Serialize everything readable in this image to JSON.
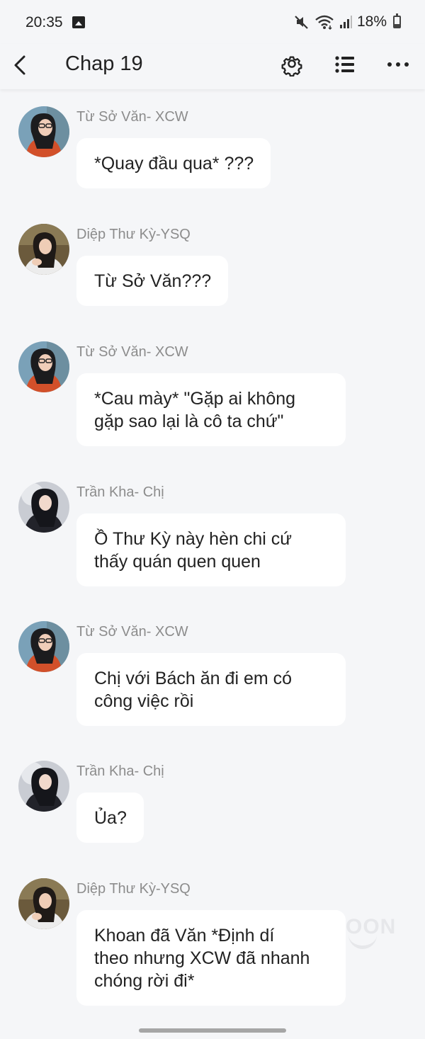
{
  "status_bar": {
    "time": "20:35",
    "battery": "18%",
    "icons": [
      "gallery-icon",
      "mute-icon",
      "wifi-icon",
      "signal-icon",
      "battery-icon"
    ]
  },
  "app_bar": {
    "title": "Chap 19",
    "icons": [
      "back-icon",
      "gear-icon",
      "list-icon",
      "more-icon"
    ]
  },
  "colors": {
    "background": "#f5f6f8",
    "bubble": "#ffffff",
    "name_text": "#8c8c8c",
    "text": "#222222"
  },
  "messages": [
    {
      "sender": "Từ Sở Văn- XCW",
      "avatar": "avatar-tu-so-van",
      "text": "*Quay đầu qua* ???"
    },
    {
      "sender": "Diệp Thư Kỳ-YSQ",
      "avatar": "avatar-diep-thu-ky",
      "text": "Từ Sở Văn???"
    },
    {
      "sender": "Từ Sở Văn- XCW",
      "avatar": "avatar-tu-so-van",
      "text": "*Cau mày* \"Gặp ai không\ngặp sao lại là cô ta chứ\""
    },
    {
      "sender": "Trần Kha- Chị",
      "avatar": "avatar-tran-kha",
      "text": "Ồ Thư Kỳ này hèn chi cứ\nthấy quán quen quen"
    },
    {
      "sender": "Từ Sở Văn- XCW",
      "avatar": "avatar-tu-so-van",
      "text": "Chị với Bách ăn đi em có\ncông việc rồi"
    },
    {
      "sender": "Trần Kha- Chị",
      "avatar": "avatar-tran-kha",
      "text": "Ủa?"
    },
    {
      "sender": "Diệp Thư Kỳ-YSQ",
      "avatar": "avatar-diep-thu-ky",
      "text": "Khoan đã Văn *Định dí\ntheo nhưng XCW đã nhanh\nchóng rời đi*"
    }
  ],
  "watermark": "OON"
}
